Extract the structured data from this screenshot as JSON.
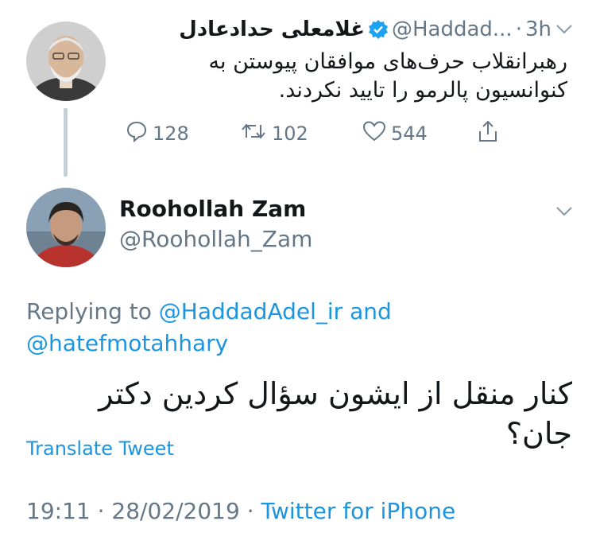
{
  "parent_tweet": {
    "display_name": "غلامعلی حدادعادل",
    "handle": "@Haddad...",
    "separator": "·",
    "time": "3h",
    "text_line1": "رهبرانقلاب حرف‌های موافقان پیوستن به",
    "text_line2": "کنوانسیون پالرمو را تایید نکردند.",
    "verified": true,
    "actions": {
      "replies": "128",
      "retweets": "102",
      "likes": "544"
    }
  },
  "reply_tweet": {
    "display_name": "Roohollah Zam",
    "handle": "@Roohollah_Zam",
    "replying_to_prefix": "Replying to",
    "replying_to_user1": "@HaddadAdel_ir",
    "replying_to_conj": "and",
    "replying_to_user2": "@hatefmotahhary",
    "text": "کنار منقل از ایشون سؤال کردین دکتر جان؟",
    "translate_label": "Translate Tweet",
    "time": "19:11",
    "date": "28/02/2019",
    "separator": "·",
    "source": "Twitter for iPhone"
  },
  "colors": {
    "link": "#1b95e0",
    "muted": "#657786",
    "text": "#14171a",
    "thread_line": "#c4cfd6",
    "verified": "#1da1f2"
  },
  "icons": {
    "reply": "speech-bubble-icon",
    "retweet": "retweet-icon",
    "like": "heart-icon",
    "share": "share-icon",
    "verified": "verified-badge-icon",
    "menu": "chevron-down-icon"
  }
}
